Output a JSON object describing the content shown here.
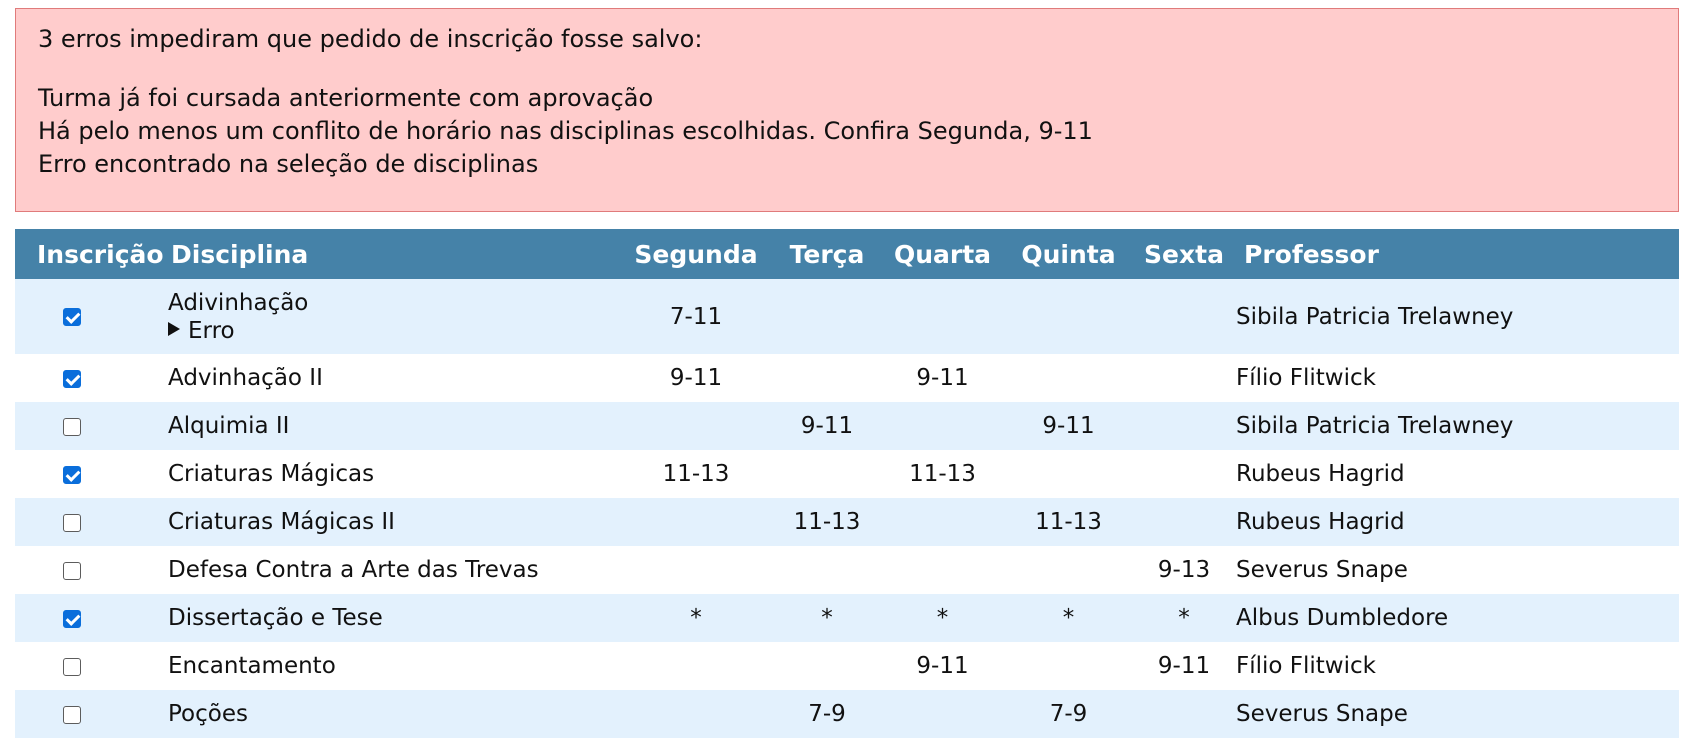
{
  "errors": {
    "summary": "3 erros impediram que pedido de inscrição fosse salvo:",
    "messages": [
      "Turma já foi cursada anteriormente com aprovação",
      "Há pelo menos um conflito de horário nas disciplinas escolhidas. Confira Segunda, 9-11",
      "Erro encontrado na seleção de disciplinas"
    ]
  },
  "table": {
    "headers": {
      "inscricao": "Inscrição",
      "disciplina": "Disciplina",
      "segunda": "Segunda",
      "terca": "Terça",
      "quarta": "Quarta",
      "quinta": "Quinta",
      "sexta": "Sexta",
      "professor": "Professor"
    },
    "rows": [
      {
        "checked": true,
        "name": "Adivinhação",
        "details": "Erro",
        "segunda": "7-11",
        "terca": "",
        "quarta": "",
        "quinta": "",
        "sexta": "",
        "professor": "Sibila Patricia Trelawney"
      },
      {
        "checked": true,
        "name": "Advinhação II",
        "segunda": "9-11",
        "terca": "",
        "quarta": "9-11",
        "quinta": "",
        "sexta": "",
        "professor": "Fílio Flitwick"
      },
      {
        "checked": false,
        "name": "Alquimia II",
        "segunda": "",
        "terca": "9-11",
        "quarta": "",
        "quinta": "9-11",
        "sexta": "",
        "professor": "Sibila Patricia Trelawney"
      },
      {
        "checked": true,
        "name": "Criaturas Mágicas",
        "segunda": "11-13",
        "terca": "",
        "quarta": "11-13",
        "quinta": "",
        "sexta": "",
        "professor": "Rubeus Hagrid"
      },
      {
        "checked": false,
        "name": "Criaturas Mágicas II",
        "segunda": "",
        "terca": "11-13",
        "quarta": "",
        "quinta": "11-13",
        "sexta": "",
        "professor": "Rubeus Hagrid"
      },
      {
        "checked": false,
        "name": "Defesa Contra a Arte das Trevas",
        "segunda": "",
        "terca": "",
        "quarta": "",
        "quinta": "",
        "sexta": "9-13",
        "professor": "Severus Snape"
      },
      {
        "checked": true,
        "name": "Dissertação e Tese",
        "segunda": "*",
        "terca": "*",
        "quarta": "*",
        "quinta": "*",
        "sexta": "*",
        "professor": "Albus Dumbledore"
      },
      {
        "checked": false,
        "name": "Encantamento",
        "segunda": "",
        "terca": "",
        "quarta": "9-11",
        "quinta": "",
        "sexta": "9-11",
        "professor": "Fílio Flitwick"
      },
      {
        "checked": false,
        "name": "Poções",
        "segunda": "",
        "terca": "7-9",
        "quarta": "",
        "quinta": "7-9",
        "sexta": "",
        "professor": "Severus Snape"
      }
    ]
  }
}
